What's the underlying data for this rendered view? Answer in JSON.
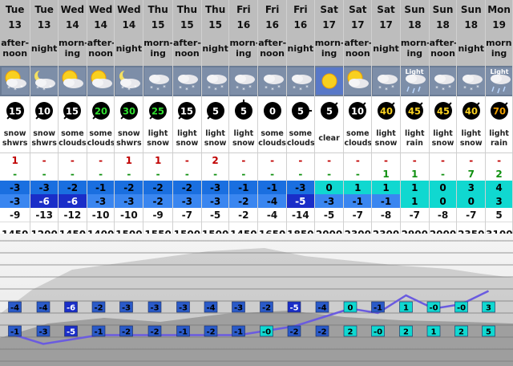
{
  "columns": [
    {
      "day": "Tue",
      "date": "13",
      "period": "after-noon",
      "icon": "partly-cloudy-snow-icon",
      "wind": 15,
      "wind_dir": "sw",
      "desc": "snow shwrs",
      "snow": "1",
      "rain": "-",
      "tmax": "-3",
      "tmin": "-3",
      "chill": "-9",
      "fl": "1450"
    },
    {
      "day": "Tue",
      "date": "13",
      "period": "night",
      "icon": "moon-cloud-snow-icon",
      "wind": 10,
      "wind_dir": "sw",
      "desc": "snow shwrs",
      "snow": "-",
      "rain": "-",
      "tmax": "-3",
      "tmin": "-6",
      "chill": "-13",
      "fl": "1200"
    },
    {
      "day": "Wed",
      "date": "14",
      "period": "morn-ing",
      "icon": "partly-cloudy-icon",
      "wind": 15,
      "wind_dir": "sw",
      "desc": "some clouds",
      "snow": "-",
      "rain": "-",
      "tmax": "-2",
      "tmin": "-6",
      "chill": "-12",
      "fl": "1450"
    },
    {
      "day": "Wed",
      "date": "14",
      "period": "after-noon",
      "icon": "partly-cloudy-icon",
      "wind": 20,
      "wind_dir": "sw",
      "desc": "some clouds",
      "snow": "-",
      "rain": "-",
      "tmax": "-1",
      "tmin": "-3",
      "chill": "-10",
      "fl": "1400"
    },
    {
      "day": "Wed",
      "date": "14",
      "period": "night",
      "icon": "moon-cloud-snow-icon",
      "wind": 30,
      "wind_dir": "sw",
      "desc": "snow shwrs",
      "snow": "1",
      "rain": "-",
      "tmax": "-2",
      "tmin": "-3",
      "chill": "-10",
      "fl": "1500"
    },
    {
      "day": "Thu",
      "date": "15",
      "period": "morn-ing",
      "icon": "cloud-snow-icon",
      "wind": 25,
      "wind_dir": "sw",
      "desc": "light snow",
      "snow": "1",
      "rain": "-",
      "tmax": "-2",
      "tmin": "-2",
      "chill": "-9",
      "fl": "1550"
    },
    {
      "day": "Thu",
      "date": "15",
      "period": "after-noon",
      "icon": "cloud-snow-icon",
      "wind": 15,
      "wind_dir": "sw",
      "desc": "light snow",
      "snow": "-",
      "rain": "-",
      "tmax": "-2",
      "tmin": "-3",
      "chill": "-7",
      "fl": "1500"
    },
    {
      "day": "Thu",
      "date": "15",
      "period": "night",
      "icon": "cloud-snow-icon",
      "wind": 5,
      "wind_dir": "sw",
      "desc": "light snow",
      "snow": "2",
      "rain": "-",
      "tmax": "-3",
      "tmin": "-3",
      "chill": "-5",
      "fl": "1500"
    },
    {
      "day": "Fri",
      "date": "16",
      "period": "morn-ing",
      "icon": "cloud-snow-icon",
      "wind": 5,
      "wind_dir": "n",
      "desc": "light snow",
      "snow": "-",
      "rain": "-",
      "tmax": "-1",
      "tmin": "-2",
      "chill": "-2",
      "fl": "1450"
    },
    {
      "day": "Fri",
      "date": "16",
      "period": "after-noon",
      "icon": "cloud-snow-icon",
      "wind": 0,
      "wind_dir": "none",
      "desc": "some clouds",
      "snow": "-",
      "rain": "-",
      "tmax": "-1",
      "tmin": "-4",
      "chill": "-4",
      "fl": "1650"
    },
    {
      "day": "Fri",
      "date": "16",
      "period": "night",
      "icon": "cloud-snow-icon",
      "wind": 5,
      "wind_dir": "e",
      "desc": "some clouds",
      "snow": "-",
      "rain": "-",
      "tmax": "-3",
      "tmin": "-5",
      "chill": "-14",
      "fl": "1850"
    },
    {
      "day": "Sat",
      "date": "17",
      "period": "morn-ing",
      "icon": "sun-icon",
      "wind": 5,
      "wind_dir": "ne",
      "desc": "clear",
      "snow": "-",
      "rain": "-",
      "tmax": "0",
      "tmin": "-3",
      "chill": "-5",
      "fl": "2000"
    },
    {
      "day": "Sat",
      "date": "17",
      "period": "after-noon",
      "icon": "partly-cloudy-icon",
      "wind": 10,
      "wind_dir": "ne",
      "desc": "some clouds",
      "snow": "-",
      "rain": "-",
      "tmax": "1",
      "tmin": "-1",
      "chill": "-7",
      "fl": "2300"
    },
    {
      "day": "Sat",
      "date": "17",
      "period": "night",
      "icon": "cloud-snow-icon",
      "wind": 40,
      "wind_dir": "ne",
      "desc": "light snow",
      "snow": "-",
      "rain": "1",
      "tmax": "1",
      "tmin": "-1",
      "chill": "-8",
      "fl": "2300"
    },
    {
      "day": "Sun",
      "date": "18",
      "period": "morn-ing",
      "icon": "cloud-rain-icon",
      "icon_label": "Light",
      "wind": 45,
      "wind_dir": "ne",
      "desc": "light rain",
      "snow": "-",
      "rain": "1",
      "tmax": "1",
      "tmin": "1",
      "chill": "-7",
      "fl": "2900"
    },
    {
      "day": "Sun",
      "date": "18",
      "period": "after-noon",
      "icon": "cloud-snow-icon",
      "wind": 45,
      "wind_dir": "ne",
      "desc": "light snow",
      "snow": "-",
      "rain": "-",
      "tmax": "0",
      "tmin": "0",
      "chill": "-8",
      "fl": "2000"
    },
    {
      "day": "Sun",
      "date": "18",
      "period": "night",
      "icon": "cloud-snow-icon",
      "wind": 40,
      "wind_dir": "ne",
      "desc": "light snow",
      "snow": "-",
      "rain": "7",
      "tmax": "3",
      "tmin": "0",
      "chill": "-7",
      "fl": "2350"
    },
    {
      "day": "Mon",
      "date": "19",
      "period": "morn-ing",
      "icon": "cloud-rain-icon",
      "icon_label": "Light",
      "wind": 70,
      "wind_dir": "ne",
      "desc": "light rain",
      "snow": "-",
      "rain": "2",
      "tmax": "4",
      "tmin": "3",
      "chill": "5",
      "fl": "3100"
    }
  ],
  "chart": {
    "upper_labels": [
      "-4",
      "-4",
      "-6",
      "-2",
      "-3",
      "-3",
      "-3",
      "-4",
      "-3",
      "-2",
      "-5",
      "-4",
      "0",
      "-1",
      "1",
      "-0",
      "-0",
      "3"
    ],
    "lower_labels": [
      "-1",
      "-3",
      "-5",
      "-1",
      "-2",
      "-2",
      "-1",
      "-2",
      "-1",
      "-0",
      "-2",
      "-2",
      "2",
      "-0",
      "2",
      "1",
      "2",
      "5"
    ],
    "line_values": [
      -1,
      -3,
      -2,
      -1,
      -1,
      -1,
      -1,
      -1,
      -1,
      0,
      1,
      3,
      5,
      4,
      8,
      5,
      6,
      9
    ]
  },
  "colors": {
    "header_gray": "#bdbdbd",
    "tmax_blue": "#1a6fe0",
    "tmin_blue": "#3a86f0",
    "deep_blue": "#1a2ec8",
    "positive_teal": "#10d8d0",
    "snow_red": "#c00000",
    "rain_green": "#109010",
    "line_purple": "#6a5be0"
  }
}
